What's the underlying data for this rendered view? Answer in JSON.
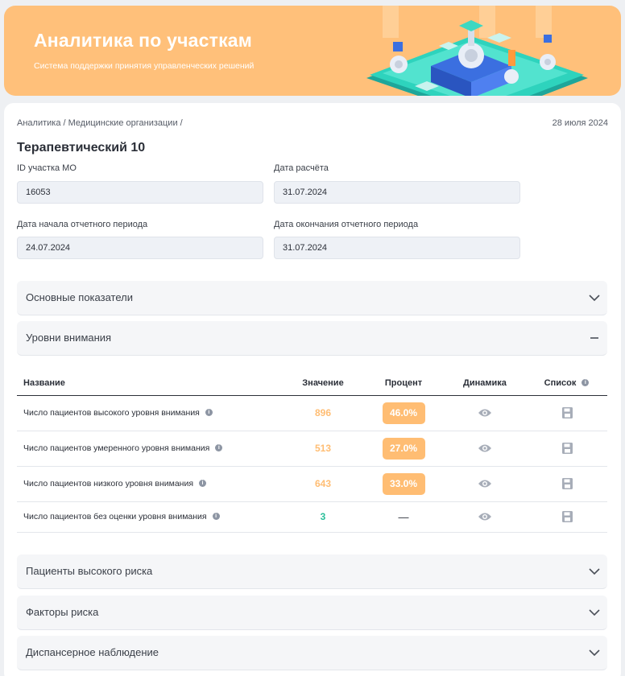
{
  "banner": {
    "title": "Аналитика по участкам",
    "subtitle": "Система поддержки принятия управленческих решений"
  },
  "breadcrumb": "Аналитика / Медицинские организации /",
  "date": "28 июля 2024",
  "page_title": "Терапевтический 10",
  "fields": {
    "id_label": "ID участка МО",
    "id_value": "16053",
    "calc_date_label": "Дата расчёта",
    "calc_date_value": "31.07.2024",
    "start_label": "Дата начала отчетного периода",
    "start_value": "24.07.2024",
    "end_label": "Дата окончания отчетного периода",
    "end_value": "31.07.2024"
  },
  "accordions": {
    "main": "Основные показатели",
    "attention": "Уровни внимания",
    "high_risk": "Пациенты высокого риска",
    "risk_factors": "Факторы риска",
    "dispensary": "Диспансерное наблюдение"
  },
  "table": {
    "headers": {
      "name": "Название",
      "value": "Значение",
      "percent": "Процент",
      "dynamics": "Динамика",
      "list": "Список"
    },
    "rows": [
      {
        "name": "Число пациентов высокого уровня внимания",
        "value": "896",
        "percent": "46.0%"
      },
      {
        "name": "Число пациентов умеренного уровня внимания",
        "value": "513",
        "percent": "27.0%"
      },
      {
        "name": "Число пациентов низкого уровня внимания",
        "value": "643",
        "percent": "33.0%"
      },
      {
        "name": "Число пациентов без оценки уровня внимания",
        "value": "3",
        "percent": "—"
      }
    ]
  },
  "colors": {
    "accent_orange": "#ffbd73",
    "value_green": "#2bbf9a",
    "banner_bg": "#ffc07a"
  },
  "icons": {
    "collapse": "chevron-down-icon",
    "expand": "minus-icon",
    "dynamics": "eye-icon",
    "list": "floppy-disk-icon",
    "info": "info-icon"
  }
}
